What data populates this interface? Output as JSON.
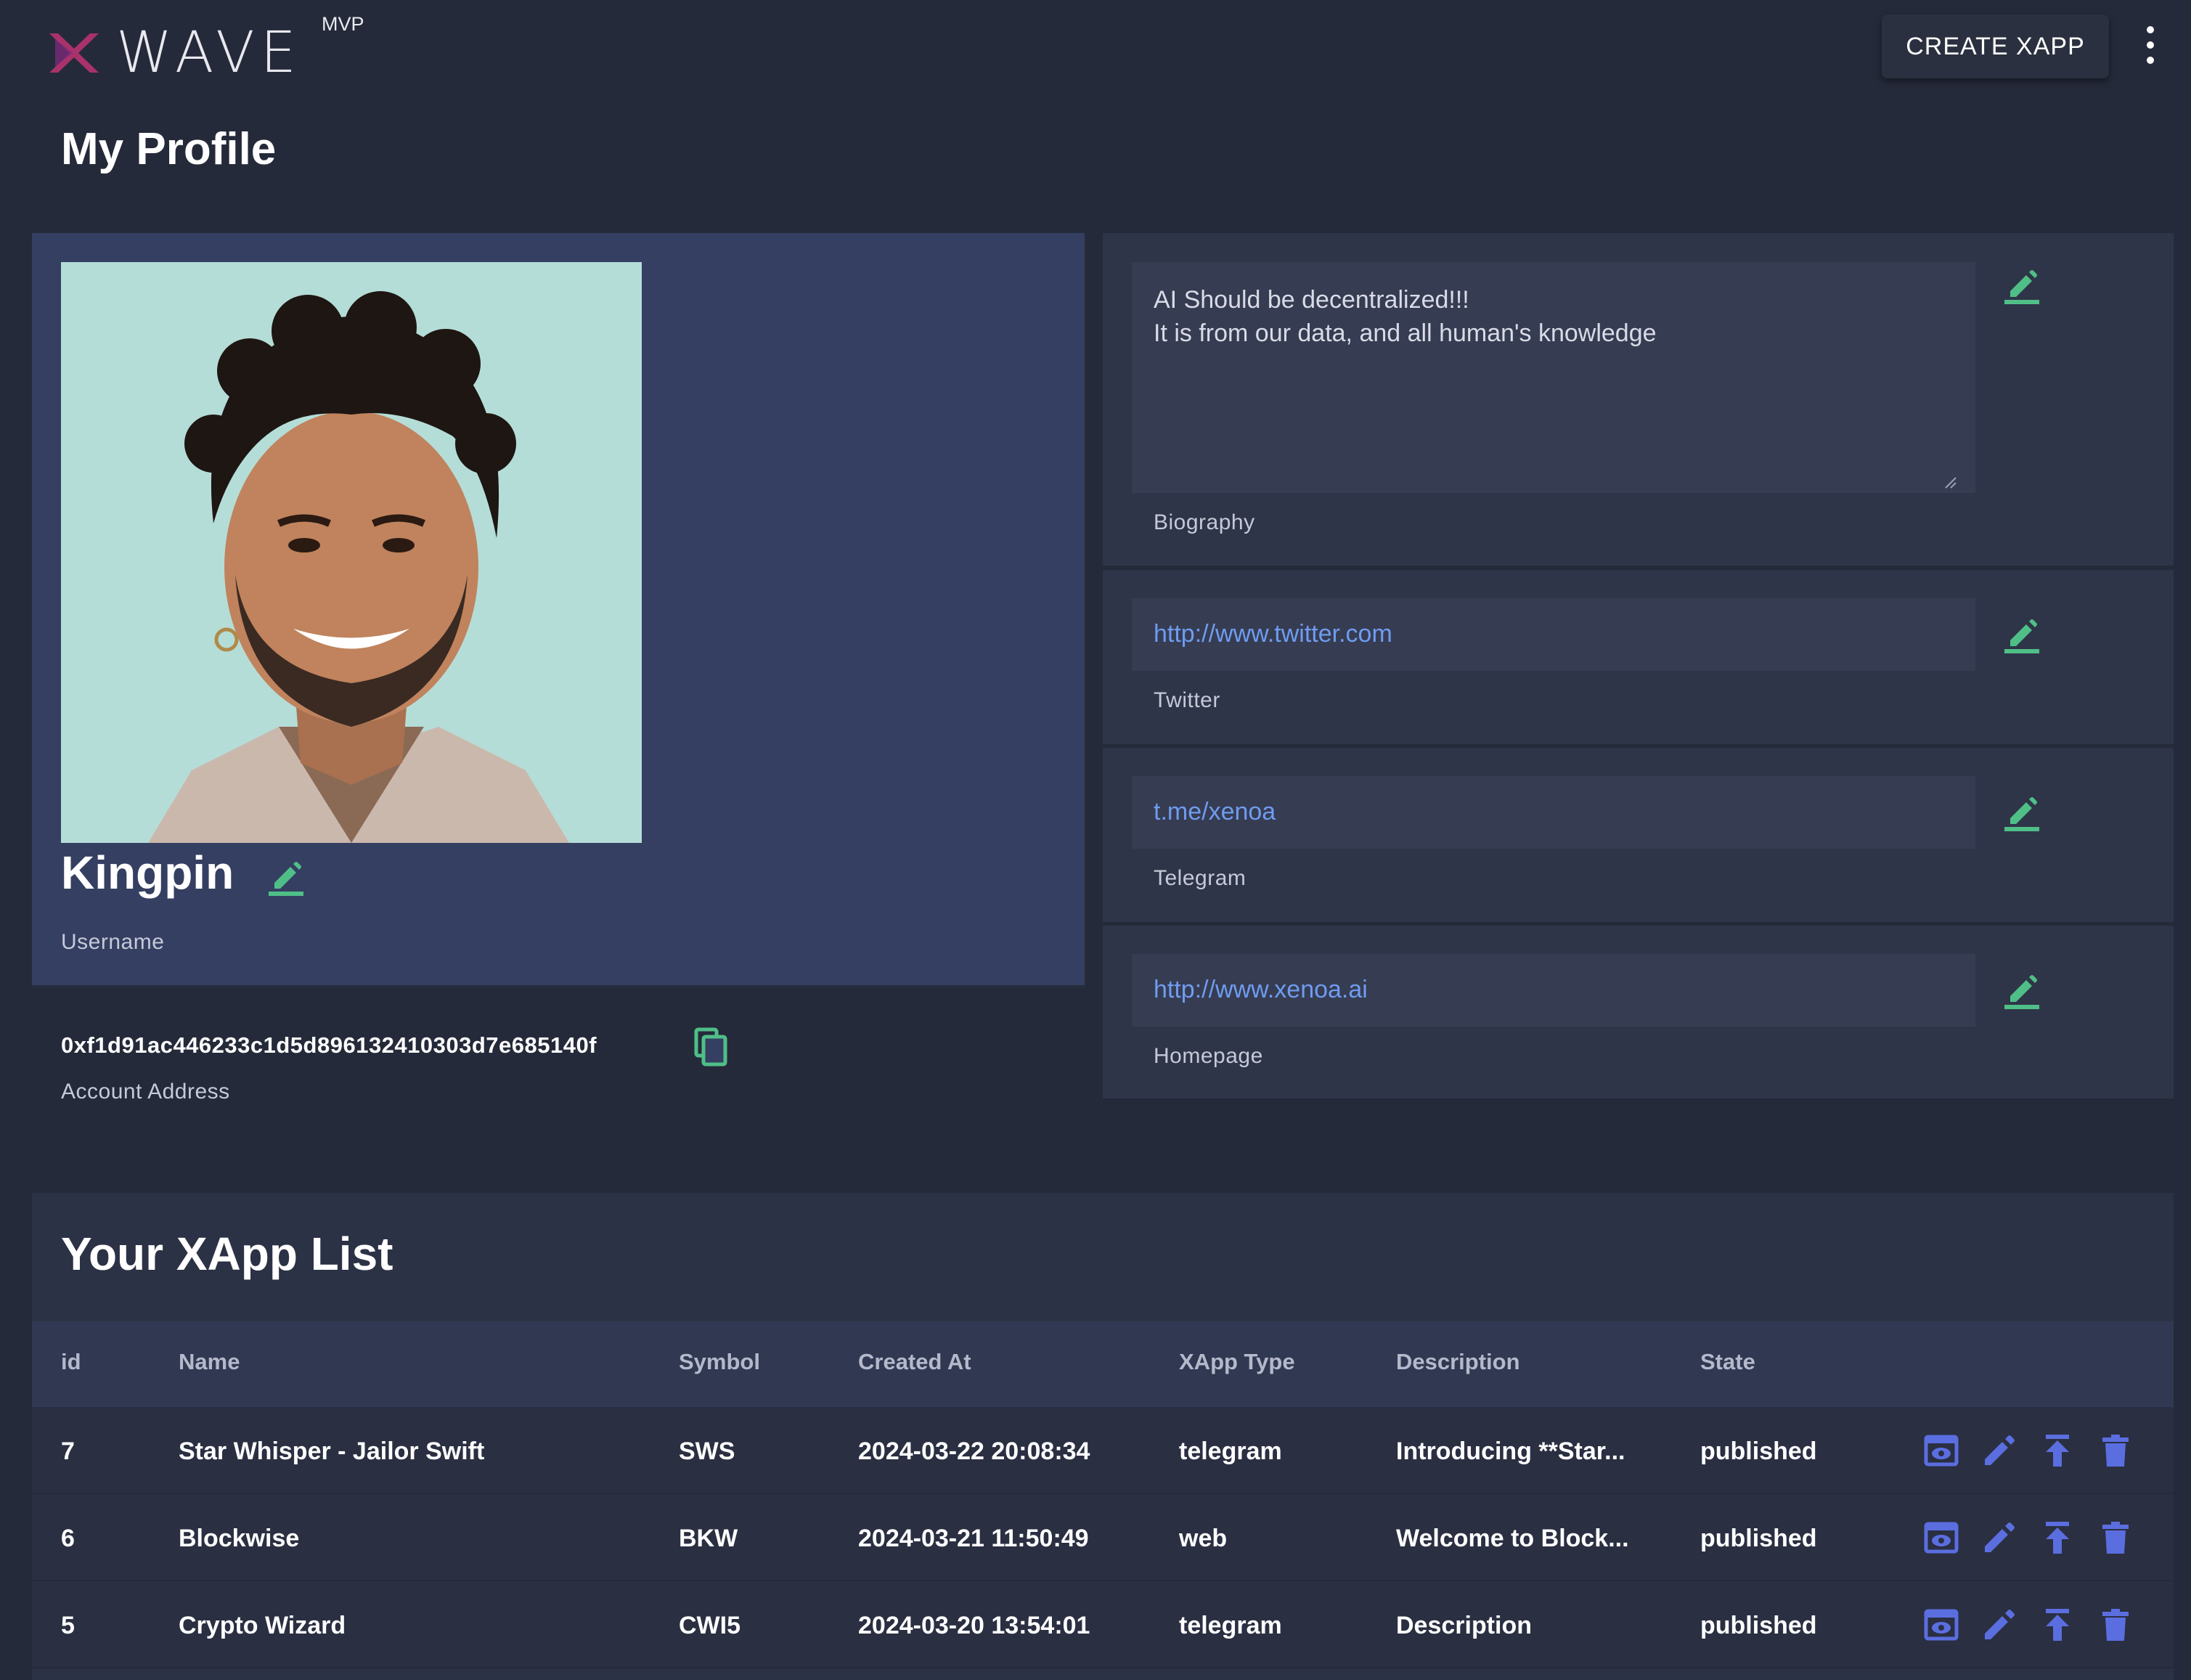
{
  "app": {
    "brand": "WAVE",
    "badge": "MVP",
    "create_button": "CREATE XAPP",
    "menu_icon": "more-vert-icon"
  },
  "page": {
    "title": "My Profile"
  },
  "profile": {
    "username": "Kingpin",
    "username_label": "Username",
    "account_address": "0xf1d91ac446233c1d5d896132410303d7e685140f",
    "account_address_label": "Account Address",
    "biography_lines": [
      "AI Should be decentralized!!!",
      "It is from our data, and all human's knowledge"
    ],
    "biography_label": "Biography",
    "twitter": "http://www.twitter.com",
    "twitter_label": "Twitter",
    "telegram": "t.me/xenoa",
    "telegram_label": "Telegram",
    "homepage": "http://www.xenoa.ai",
    "homepage_label": "Homepage"
  },
  "xapp_list": {
    "title": "Your XApp List",
    "columns": [
      "id",
      "Name",
      "Symbol",
      "Created At",
      "XApp Type",
      "Description",
      "State"
    ],
    "rows": [
      [
        "7",
        "Star Whisper - Jailor Swift",
        "SWS",
        "2024-03-22 20:08:34",
        "telegram",
        "Introducing **Star...",
        "published"
      ],
      [
        "6",
        "Blockwise",
        "BKW",
        "2024-03-21 11:50:49",
        "web",
        "Welcome to Block...",
        "published"
      ],
      [
        "5",
        "Crypto Wizard",
        "CWI5",
        "2024-03-20 13:54:01",
        "telegram",
        "Description",
        "published"
      ]
    ],
    "row_actions": [
      "preview-icon",
      "edit-icon",
      "publish-icon",
      "delete-icon"
    ]
  },
  "colors": {
    "background": "#252a3a",
    "profile_card": "#353f62",
    "edit_icon": "#4fbf87",
    "link": "#6f9cf0",
    "action_icon": "#5b6ee0"
  }
}
